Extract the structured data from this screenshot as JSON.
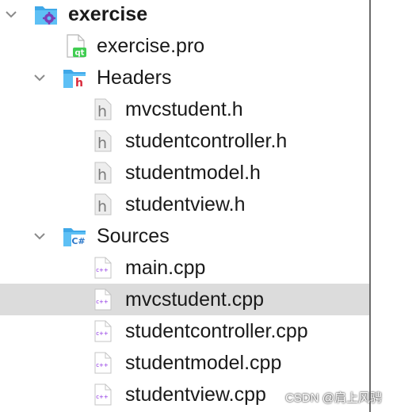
{
  "tree": {
    "project": {
      "label": "exercise",
      "icon": "qt-project-folder-icon"
    },
    "pro_file": {
      "label": "exercise.pro",
      "icon": "qt-file-icon"
    },
    "headers": {
      "label": "Headers",
      "icon": "header-folder-icon",
      "items": [
        {
          "label": "mvcstudent.h"
        },
        {
          "label": "studentcontroller.h"
        },
        {
          "label": "studentmodel.h"
        },
        {
          "label": "studentview.h"
        }
      ]
    },
    "sources": {
      "label": "Sources",
      "icon": "cpp-folder-icon",
      "items": [
        {
          "label": "main.cpp"
        },
        {
          "label": "mvcstudent.cpp",
          "selected": true
        },
        {
          "label": "studentcontroller.cpp"
        },
        {
          "label": "studentmodel.cpp"
        },
        {
          "label": "studentview.cpp"
        }
      ]
    }
  },
  "watermark": "CSDN @肩上风骋",
  "colors": {
    "folder_blue": "#3fa8e8",
    "qt_green": "#41cd52",
    "header_red": "#d9283a",
    "cpp_purple": "#8a2be2",
    "selection": "#dcdcdc"
  }
}
